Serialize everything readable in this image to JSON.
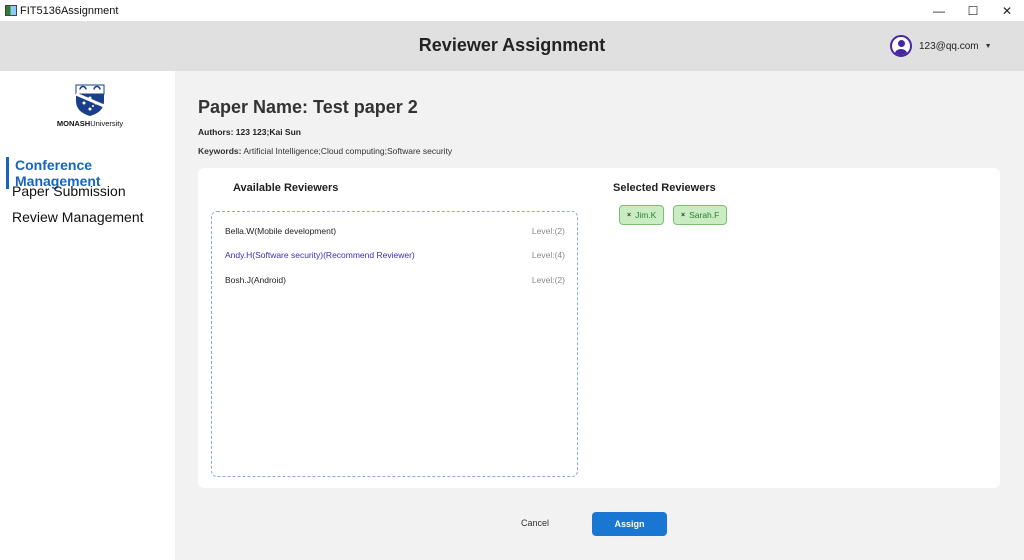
{
  "window": {
    "title": "FIT5136Assignment",
    "controls": {
      "minimize": "—",
      "maximize": "☐",
      "close": "✕"
    }
  },
  "header": {
    "title": "Reviewer Assignment",
    "user_email": "123@qq.com",
    "user_icon": "user-circle-icon",
    "dropdown_icon": "caret-down-icon"
  },
  "sidebar": {
    "logo": {
      "brand_bold": "MONASH",
      "brand_light": "University"
    },
    "items": [
      {
        "label": "Conference Management",
        "active": true
      },
      {
        "label": "Paper Submission",
        "active": false
      },
      {
        "label": "Review Management",
        "active": false
      }
    ]
  },
  "paper": {
    "name_label": "Paper Name: Test paper 2",
    "authors": "Authors: 123 123;Kai Sun",
    "keywords_label": "Keywords:",
    "keywords_value": " Artificial Intelligence;Cloud computing;Software security"
  },
  "available": {
    "title": "Available Reviewers",
    "reviewers": [
      {
        "name": "Bella.W(Mobile development)",
        "level": "Level:(2)"
      },
      {
        "name": "Andy.H(Software security)(Recommend Reviewer)",
        "level": "Level:(4)"
      },
      {
        "name": "Bosh.J(Android)",
        "level": "Level:(2)"
      }
    ]
  },
  "selected": {
    "title": "Selected Reviewers",
    "chips": [
      {
        "name": "Jim.K",
        "remove": "×"
      },
      {
        "name": "Sarah.F",
        "remove": "×"
      }
    ]
  },
  "actions": {
    "cancel": "Cancel",
    "assign": "Assign"
  },
  "colors": {
    "accent": "#1976d2",
    "active_nav": "#1565c0",
    "recommend": "#3b2fb8",
    "chip_bg": "#c9ecc2",
    "chip_border": "#7cbf74",
    "chip_text": "#2e7d32"
  }
}
